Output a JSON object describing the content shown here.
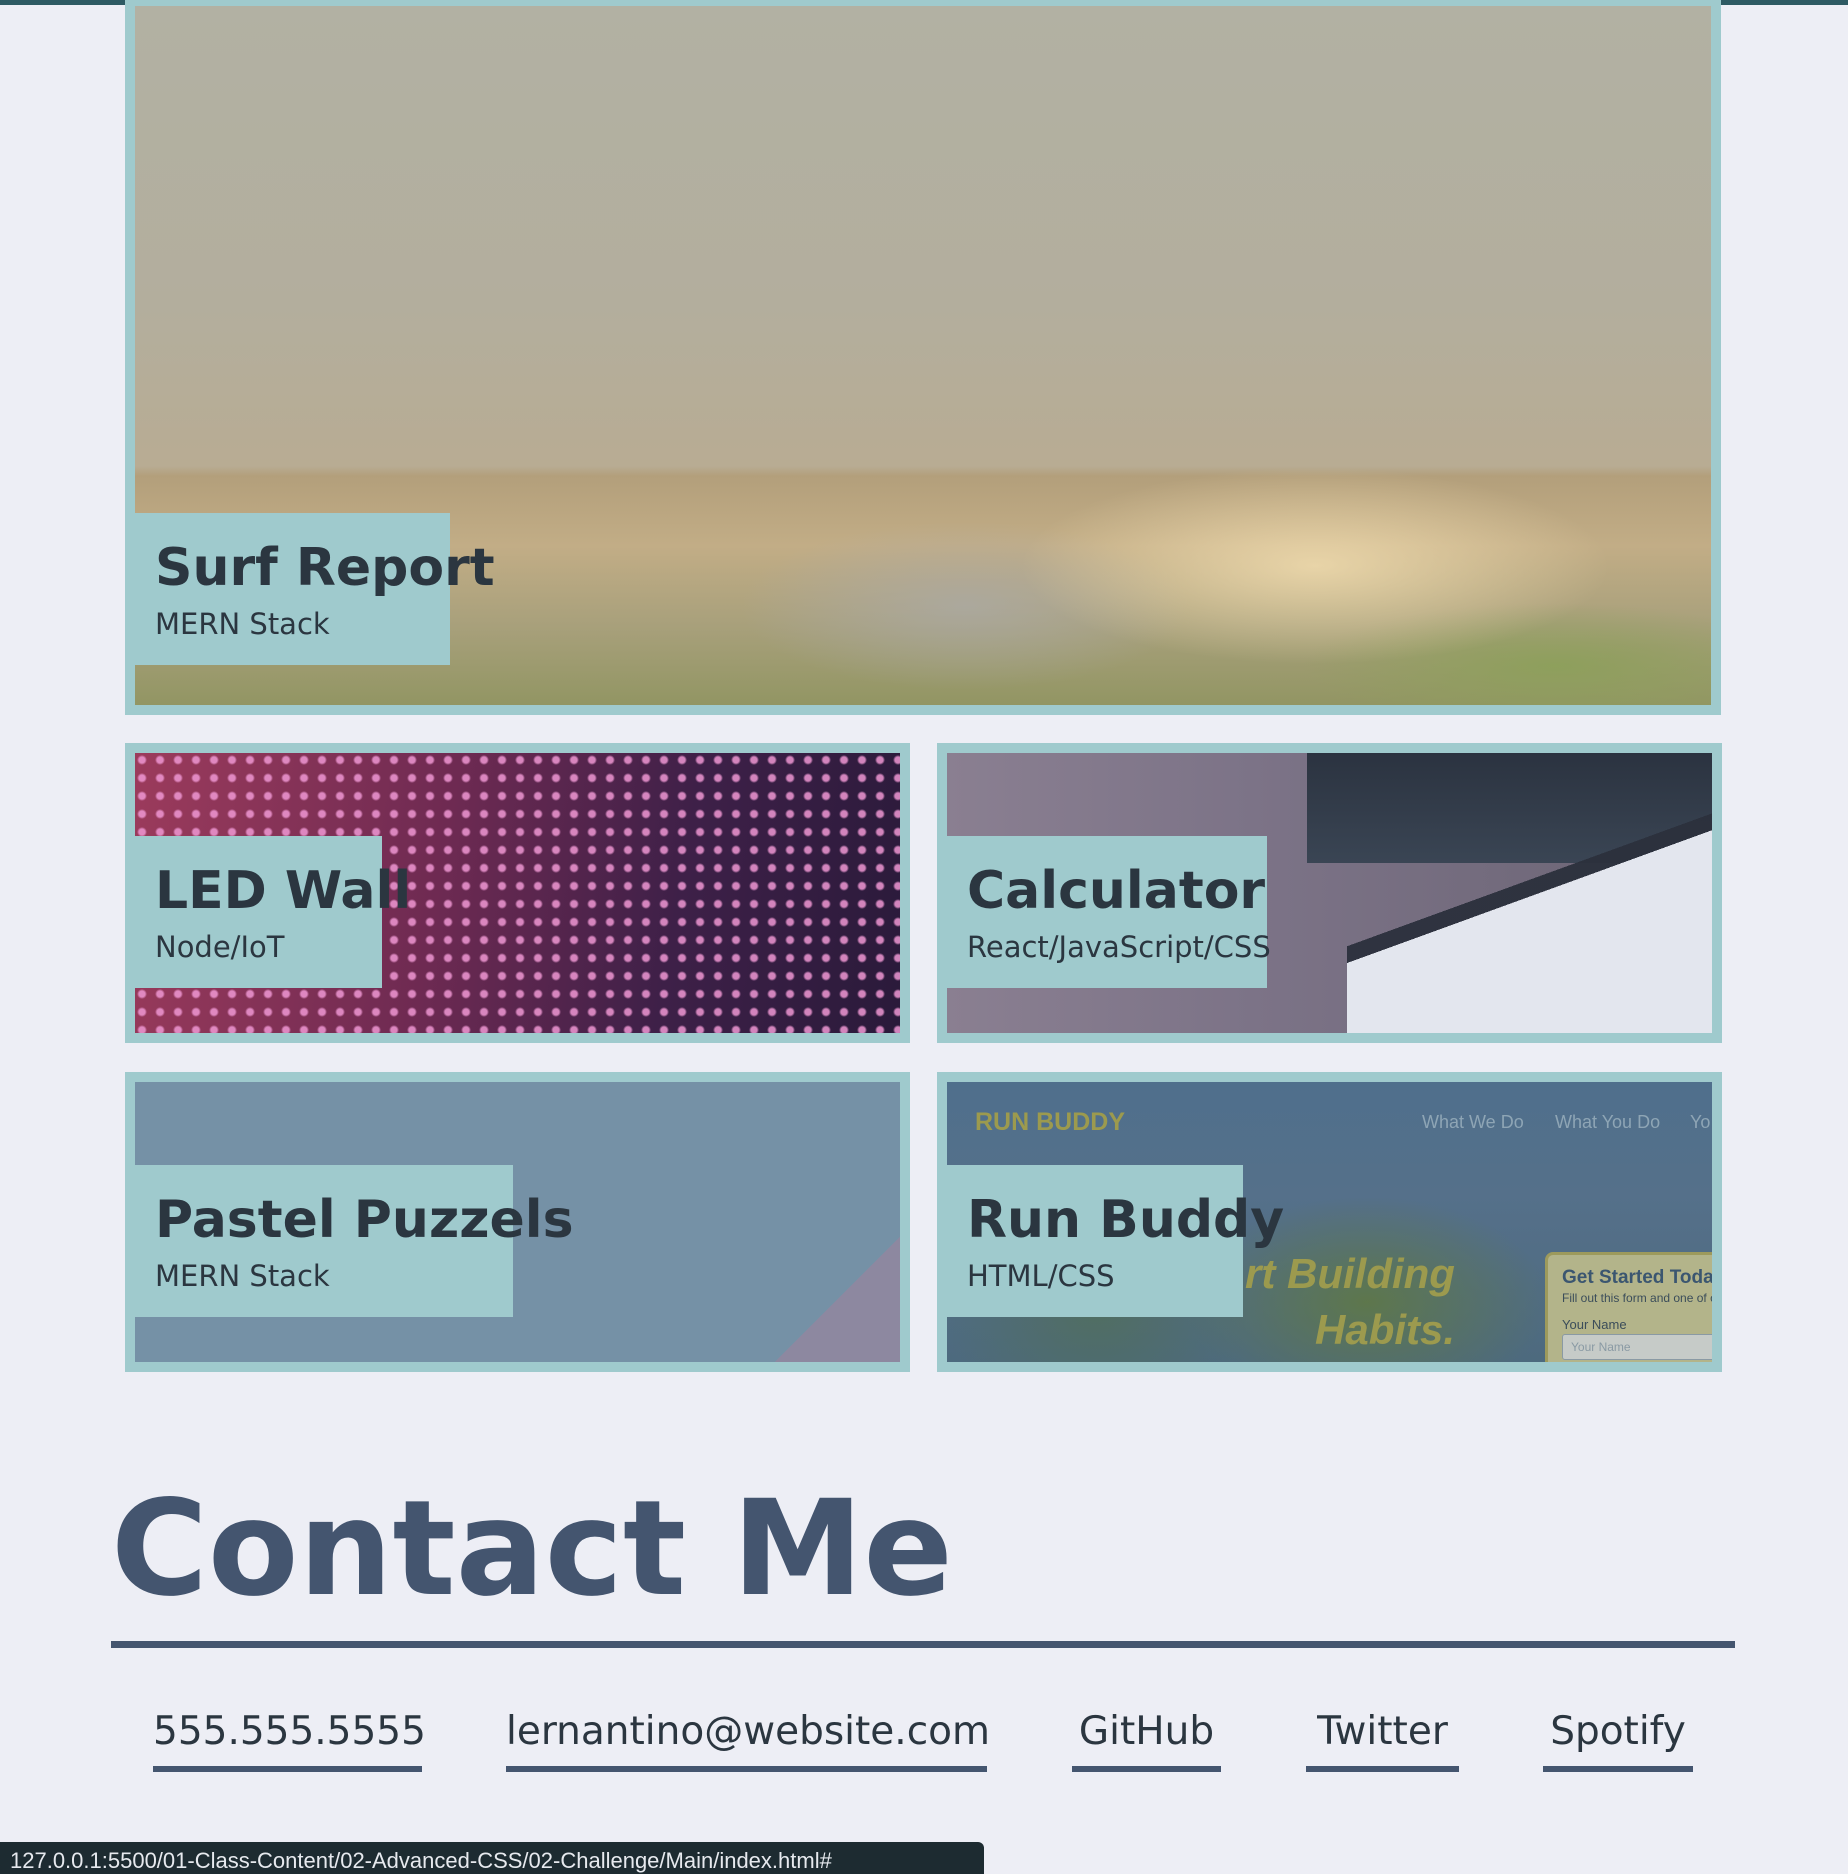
{
  "projects": {
    "surf": {
      "title": "Surf Report",
      "stack": "MERN Stack"
    },
    "led": {
      "title": "LED Wall",
      "stack": "Node/IoT"
    },
    "calc": {
      "title": "Calculator",
      "stack": "React/JavaScript/CSS"
    },
    "pastel": {
      "title": "Pastel Puzzels",
      "stack": "MERN Stack"
    },
    "run": {
      "title": "Run Buddy",
      "stack": "HTML/CSS",
      "screenshot": {
        "brand": "RUN BUDDY",
        "nav": [
          "What We Do",
          "What You Do",
          "Yo"
        ],
        "headline_1": "rt Building",
        "headline_2": "Habits.",
        "form_title": "Get Started Today",
        "form_subtitle": "Fill out this form and one of c",
        "form_label": "Your Name",
        "form_placeholder": "Your Name"
      }
    }
  },
  "contact": {
    "heading": "Contact Me",
    "links": {
      "phone": "555.555.5555",
      "email": "lernantino@website.com",
      "github": "GitHub",
      "twitter": "Twitter",
      "spotify": "Spotify"
    }
  },
  "status_bar": {
    "url": "127.0.0.1:5500/01-Class-Content/02-Advanced-CSS/02-Challenge/Main/index.html#"
  },
  "colors": {
    "page_background": "#edeef5",
    "card_accent": "#9fcacd",
    "heading_color": "#44556f",
    "text_color": "#2b3640"
  }
}
